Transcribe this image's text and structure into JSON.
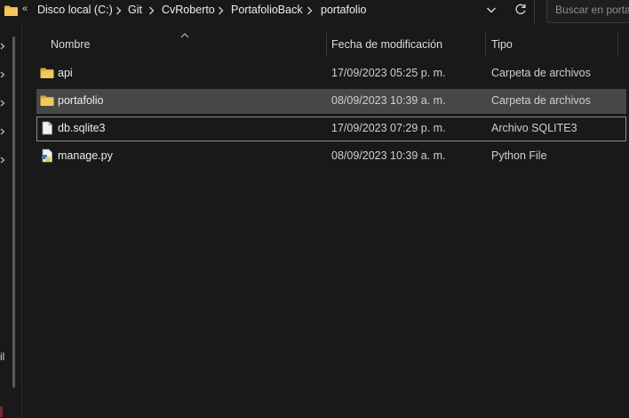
{
  "address_bar": {
    "overflow_label": "«",
    "crumbs": [
      "Disco local (C:)",
      "Git",
      "CvRoberto",
      "PortafolioBack",
      "portafolio"
    ],
    "dropdown_icon": "chevron-down-icon",
    "refresh_icon": "refresh-icon"
  },
  "search": {
    "placeholder": "Buscar en portafolio"
  },
  "nav": {
    "partial_label": "il"
  },
  "columns": {
    "name": "Nombre",
    "modified": "Fecha de modificación",
    "type": "Tipo"
  },
  "files": [
    {
      "name": "api",
      "modified": "17/09/2023 05:25 p. m.",
      "type": "Carpeta de archivos",
      "icon": "folder-icon"
    },
    {
      "name": "portafolio",
      "modified": "08/09/2023 10:39 a. m.",
      "type": "Carpeta de archivos",
      "icon": "folder-icon"
    },
    {
      "name": "db.sqlite3",
      "modified": "17/09/2023 07:29 p. m.",
      "type": "Archivo SQLITE3",
      "icon": "file-icon"
    },
    {
      "name": "manage.py",
      "modified": "08/09/2023 10:39 a. m.",
      "type": "Python File",
      "icon": "python-file-icon"
    }
  ],
  "colors": {
    "background": "#191919",
    "selected_row": "#474747",
    "folder": "#e8b84a"
  }
}
